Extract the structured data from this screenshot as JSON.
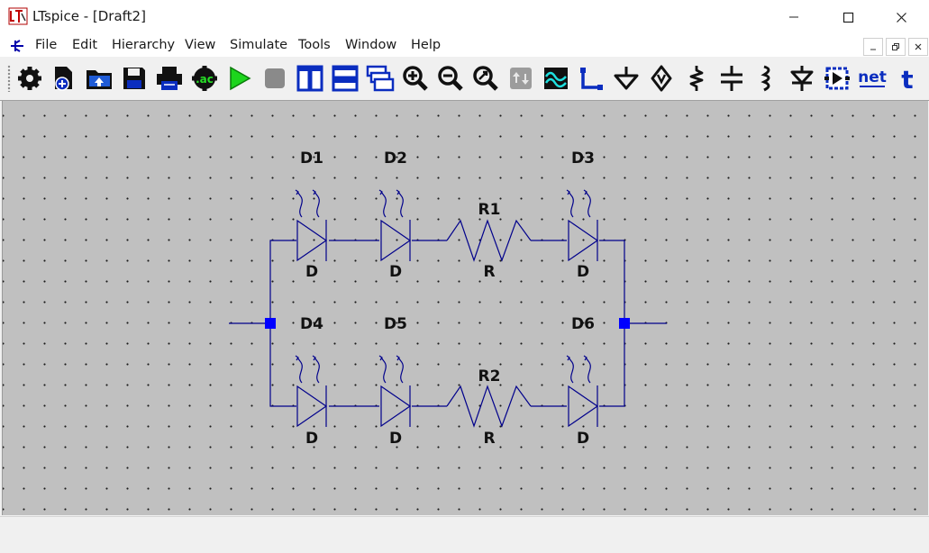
{
  "window": {
    "title": "LTspice - [Draft2]",
    "controls": {
      "minimize": "minimize-icon",
      "maximize": "maximize-icon",
      "close": "close-icon"
    }
  },
  "menu": {
    "items": [
      "File",
      "Edit",
      "Hierarchy",
      "View",
      "Simulate",
      "Tools",
      "Window",
      "Help"
    ]
  },
  "toolbar": {
    "tools": [
      {
        "name": "settings",
        "icon": "gear-icon"
      },
      {
        "name": "new-schematic",
        "icon": "new-document-icon"
      },
      {
        "name": "open",
        "icon": "open-folder-icon"
      },
      {
        "name": "save",
        "icon": "floppy-disk-icon"
      },
      {
        "name": "print",
        "icon": "printer-icon"
      },
      {
        "name": "edit-simulation-command",
        "icon": "simulation-command-icon",
        "text": ".ac"
      },
      {
        "name": "run",
        "icon": "play-icon"
      },
      {
        "name": "halt",
        "icon": "stop-icon"
      },
      {
        "name": "tile-vertical",
        "icon": "tile-vertical-icon"
      },
      {
        "name": "tile-horizontal",
        "icon": "tile-horizontal-icon"
      },
      {
        "name": "cascade",
        "icon": "cascade-windows-icon"
      },
      {
        "name": "zoom-in",
        "icon": "zoom-in-icon"
      },
      {
        "name": "zoom-out",
        "icon": "zoom-out-icon"
      },
      {
        "name": "zoom-fit",
        "icon": "zoom-fit-icon"
      },
      {
        "name": "autorange",
        "icon": "autorange-icon"
      },
      {
        "name": "waveform-viewer",
        "icon": "waveform-icon"
      },
      {
        "name": "draw-wire",
        "icon": "wire-icon"
      },
      {
        "name": "ground",
        "icon": "ground-icon"
      },
      {
        "name": "label-net",
        "icon": "net-label-icon"
      },
      {
        "name": "resistor",
        "icon": "resistor-icon"
      },
      {
        "name": "capacitor",
        "icon": "capacitor-icon"
      },
      {
        "name": "inductor",
        "icon": "inductor-icon"
      },
      {
        "name": "diode",
        "icon": "diode-icon"
      },
      {
        "name": "component",
        "icon": "component-icon"
      },
      {
        "name": "spice-directive",
        "icon": "net-text-icon",
        "text": "net"
      },
      {
        "name": "text",
        "icon": "text-icon",
        "text": "t"
      }
    ]
  },
  "schematic": {
    "components": [
      {
        "ref": "D1",
        "value": "D",
        "type": "led"
      },
      {
        "ref": "D2",
        "value": "D",
        "type": "led"
      },
      {
        "ref": "R1",
        "value": "R",
        "type": "resistor"
      },
      {
        "ref": "D3",
        "value": "D",
        "type": "led"
      },
      {
        "ref": "D4",
        "value": "D",
        "type": "led"
      },
      {
        "ref": "D5",
        "value": "D",
        "type": "led"
      },
      {
        "ref": "R2",
        "value": "R",
        "type": "resistor"
      },
      {
        "ref": "D6",
        "value": "D",
        "type": "led"
      }
    ],
    "wire_color": "#00008b",
    "junction_color": "#0000ff",
    "canvas_color": "#c0c0c0"
  }
}
